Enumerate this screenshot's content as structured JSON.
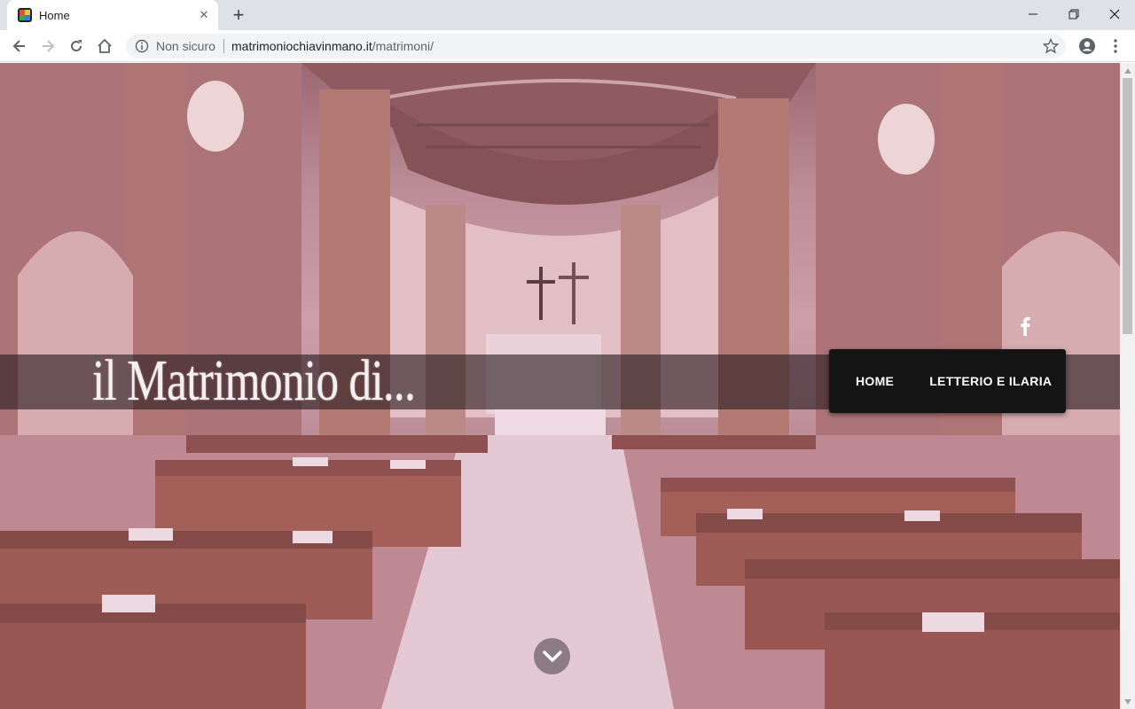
{
  "browser": {
    "tab": {
      "title": "Home",
      "close_label": "✕"
    },
    "new_tab_label": "+",
    "window_controls": {
      "minimize": "—",
      "restore": "❐",
      "close": "✕"
    },
    "address_bar": {
      "security_label": "Non sicuro",
      "url_host": "matrimoniochiavinmano.it",
      "url_path": "/matrimoni/"
    },
    "icons": {
      "back": "back-arrow-icon",
      "forward": "forward-arrow-icon",
      "reload": "reload-icon",
      "home": "home-icon",
      "info": "info-icon",
      "star": "star-icon",
      "account": "account-icon",
      "menu": "kebab-menu-icon"
    }
  },
  "page": {
    "site_title": "il Matrimonio di...",
    "social": {
      "facebook_label": "f"
    },
    "nav": {
      "items": [
        {
          "label": "HOME"
        },
        {
          "label": "LETTERIO E ILARIA"
        }
      ]
    },
    "colors": {
      "tint": "#d796b9",
      "menu_bg": "#141414",
      "band_bg": "#281c20"
    }
  }
}
